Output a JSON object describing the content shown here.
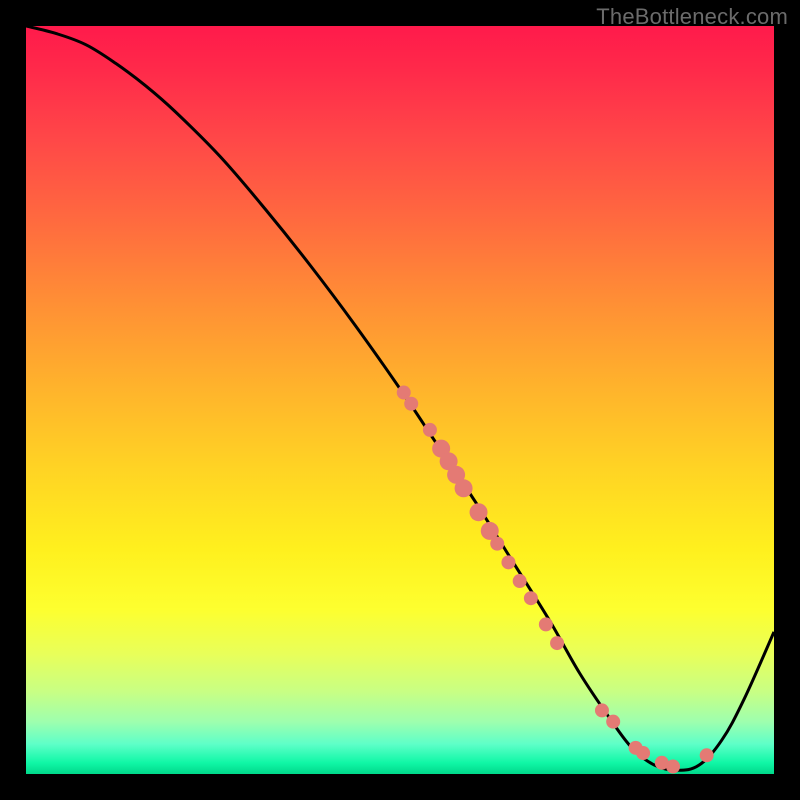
{
  "watermark": "TheBottleneck.com",
  "chart_data": {
    "type": "line",
    "title": "",
    "xlabel": "",
    "ylabel": "",
    "xlim": [
      0,
      100
    ],
    "ylim": [
      0,
      100
    ],
    "grid": false,
    "background_gradient": {
      "top": "#ff1a4b",
      "mid": "#ffe222",
      "bottom": "#00d88a"
    },
    "series": [
      {
        "name": "bottleneck-curve",
        "color": "#000000",
        "x": [
          0,
          4,
          8,
          12,
          16,
          20,
          26,
          32,
          38,
          44,
          50,
          55,
          60,
          65,
          70,
          74,
          78,
          81,
          84,
          87,
          90,
          93,
          96,
          100
        ],
        "y": [
          100,
          99,
          97.5,
          95,
          92,
          88.5,
          82.5,
          75.5,
          68,
          60,
          51.5,
          44,
          36.5,
          28.5,
          20.5,
          13.5,
          7.5,
          3.5,
          1.2,
          0.5,
          1.2,
          4.5,
          10,
          19
        ]
      }
    ],
    "markers": {
      "name": "highlight-points",
      "color": "#e47a74",
      "points": [
        {
          "x": 50.5,
          "y": 51.0,
          "r": 7
        },
        {
          "x": 51.5,
          "y": 49.5,
          "r": 7
        },
        {
          "x": 54.0,
          "y": 46.0,
          "r": 7
        },
        {
          "x": 55.5,
          "y": 43.5,
          "r": 9
        },
        {
          "x": 56.5,
          "y": 41.8,
          "r": 9
        },
        {
          "x": 57.5,
          "y": 40.0,
          "r": 9
        },
        {
          "x": 58.5,
          "y": 38.2,
          "r": 9
        },
        {
          "x": 60.5,
          "y": 35.0,
          "r": 9
        },
        {
          "x": 62.0,
          "y": 32.5,
          "r": 9
        },
        {
          "x": 63.0,
          "y": 30.8,
          "r": 7
        },
        {
          "x": 64.5,
          "y": 28.3,
          "r": 7
        },
        {
          "x": 66.0,
          "y": 25.8,
          "r": 7
        },
        {
          "x": 67.5,
          "y": 23.5,
          "r": 7
        },
        {
          "x": 69.5,
          "y": 20.0,
          "r": 7
        },
        {
          "x": 71.0,
          "y": 17.5,
          "r": 7
        },
        {
          "x": 77.0,
          "y": 8.5,
          "r": 7
        },
        {
          "x": 78.5,
          "y": 7.0,
          "r": 7
        },
        {
          "x": 81.5,
          "y": 3.5,
          "r": 7
        },
        {
          "x": 82.5,
          "y": 2.8,
          "r": 7
        },
        {
          "x": 85.0,
          "y": 1.5,
          "r": 7
        },
        {
          "x": 86.5,
          "y": 1.0,
          "r": 7
        },
        {
          "x": 91.0,
          "y": 2.5,
          "r": 7
        }
      ]
    }
  }
}
